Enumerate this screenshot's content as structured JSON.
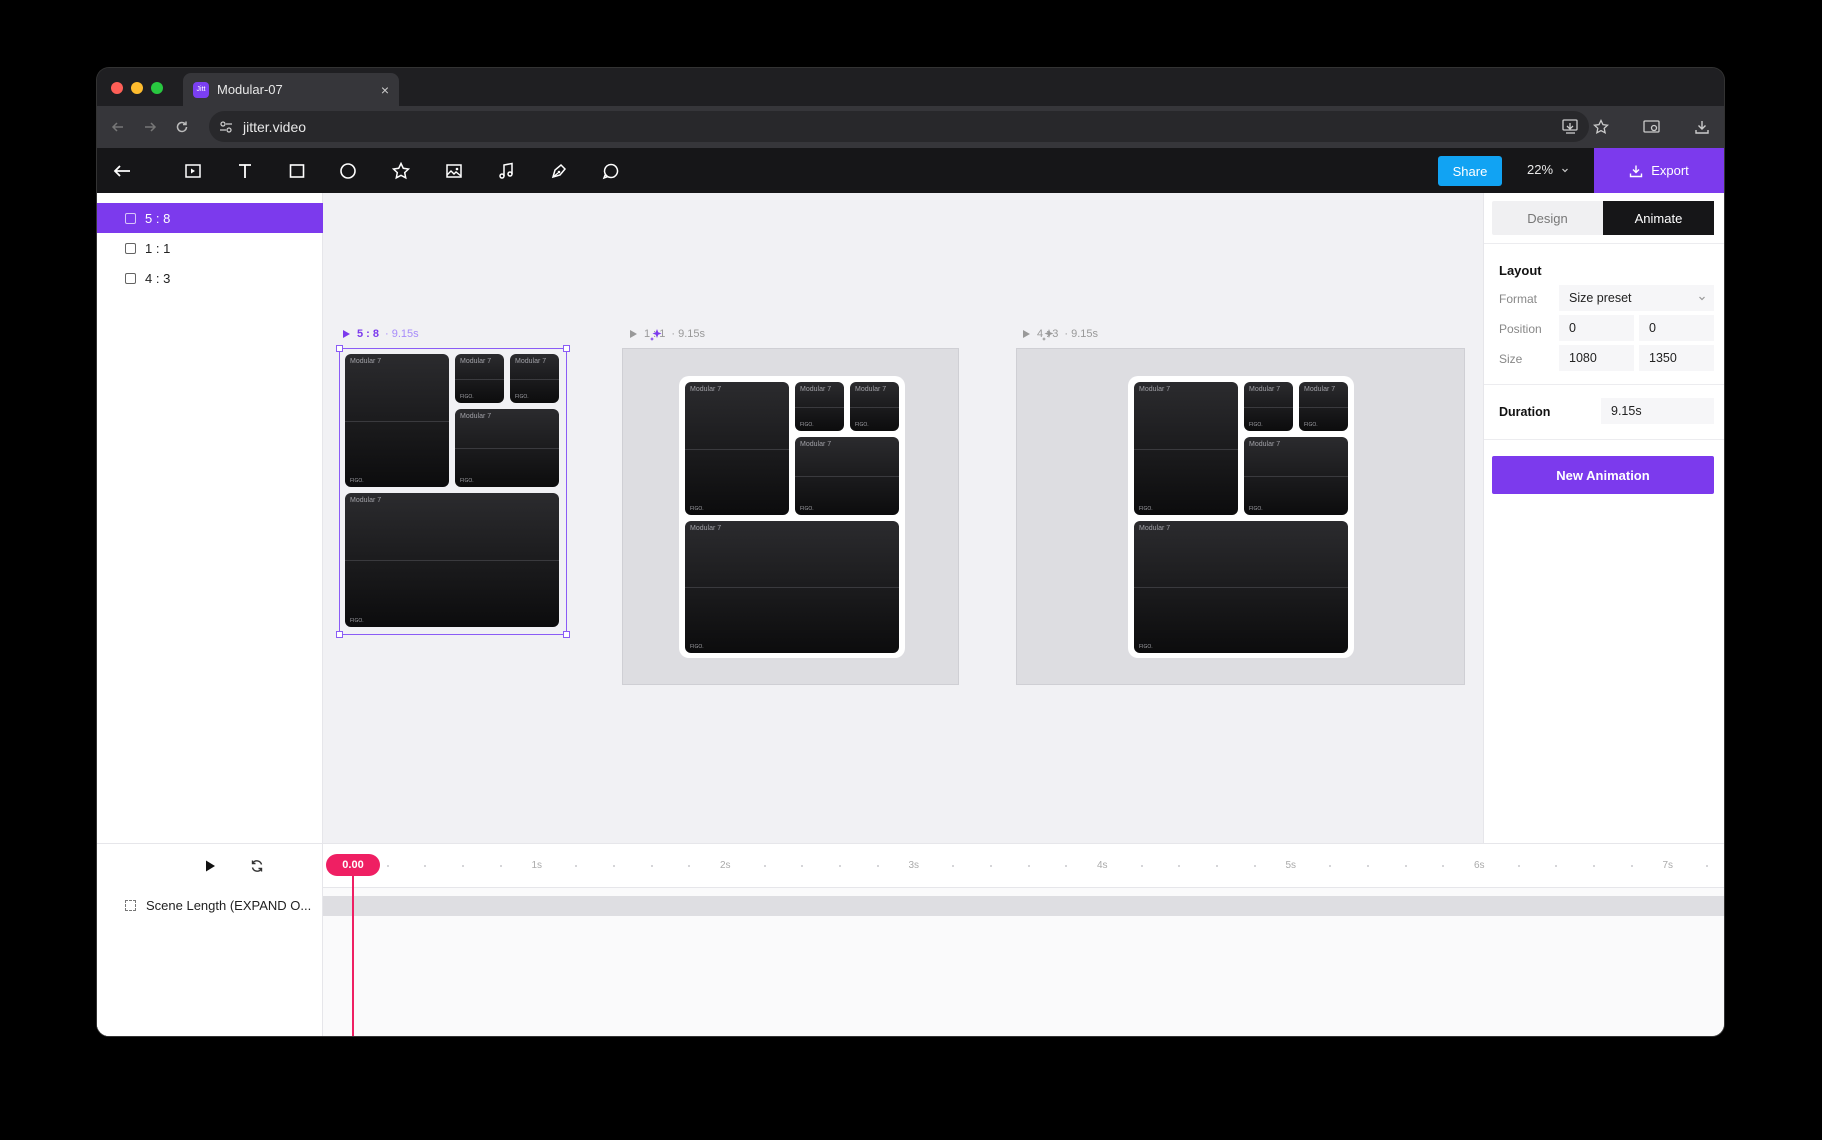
{
  "browser": {
    "tab_title": "Modular-07",
    "favicon_text": "Jitt",
    "close_glyph": "×",
    "url": "jitter.video",
    "traffic_colors": [
      "#fe5f57",
      "#febc2e",
      "#28c840"
    ]
  },
  "toolbar": {
    "tools": [
      "back-arrow-icon",
      "scene-icon",
      "text-icon",
      "rectangle-icon",
      "ellipse-icon",
      "star-icon",
      "image-icon",
      "music-icon",
      "pen-icon",
      "comment-icon"
    ],
    "share_label": "Share",
    "zoom_label": "22%",
    "export_label": "Export"
  },
  "scenes": [
    {
      "label": "5 : 8",
      "active": true
    },
    {
      "label": "1 : 1",
      "active": false
    },
    {
      "label": "4 : 3",
      "active": false
    }
  ],
  "frames": [
    {
      "name": "5 : 8",
      "duration": "· 9.15s"
    },
    {
      "name": "1 : 1",
      "duration": "· 9.15s"
    },
    {
      "name": "4 : 3",
      "duration": "· 9.15s"
    }
  ],
  "card_title": "Modular 7",
  "card_logo": "FIGO.",
  "panel": {
    "tabs": [
      "Design",
      "Animate"
    ],
    "active_tab": "Animate",
    "layout_title": "Layout",
    "format_label": "Format",
    "format_value": "Size preset",
    "position_label": "Position",
    "position_x": "0",
    "position_y": "0",
    "size_label": "Size",
    "size_w": "1080",
    "size_h": "1350",
    "duration_label": "Duration",
    "duration_value": "9.15s",
    "new_animation_label": "New Animation"
  },
  "timeline": {
    "playhead": "0.00",
    "ticks": [
      "1s",
      "2s",
      "3s",
      "4s",
      "5s",
      "6s",
      "7s"
    ],
    "track_label": "Scene Length (EXPAND O..."
  },
  "colors": {
    "accent": "#7c3aed",
    "share": "#11a3f3",
    "playhead": "#ef1f63"
  }
}
